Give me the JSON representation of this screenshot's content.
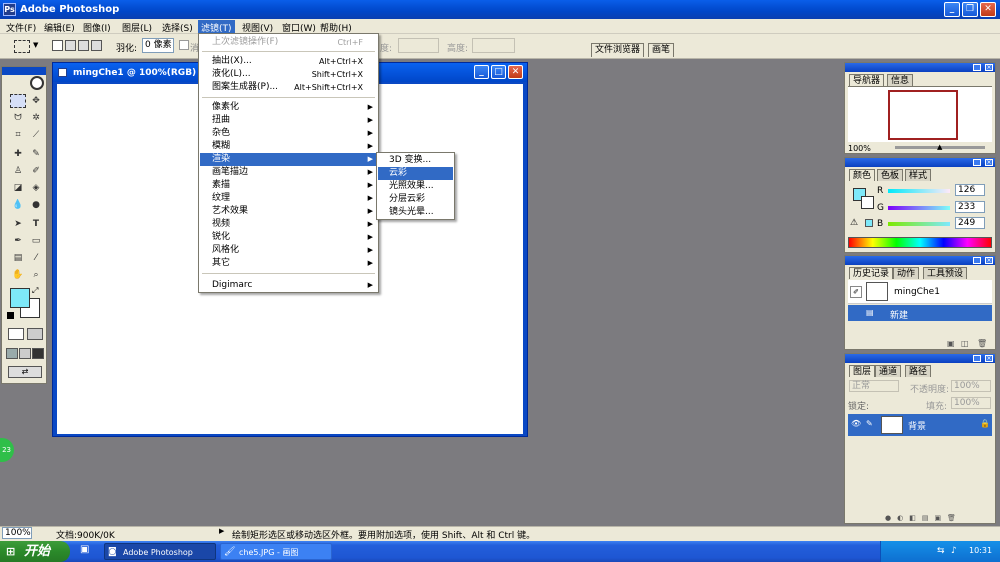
{
  "window": {
    "title": "Adobe Photoshop",
    "icon": "photoshop-app-icon"
  },
  "menubar": [
    {
      "label": "文件(F)",
      "active": false
    },
    {
      "label": "编辑(E)",
      "active": false
    },
    {
      "label": "图像(I)",
      "active": false
    },
    {
      "label": "图层(L)",
      "active": false
    },
    {
      "label": "选择(S)",
      "active": false
    },
    {
      "label": "滤镜(T)",
      "active": true
    },
    {
      "label": "视图(V)",
      "active": false
    },
    {
      "label": "窗口(W)",
      "active": false
    },
    {
      "label": "帮助(H)",
      "active": false
    }
  ],
  "options": {
    "feather_label": "羽化:",
    "feather_value": "0 像素",
    "antialias_label": "消",
    "width_label": "度:",
    "height_label": "高度:",
    "tabs": [
      "文件浏览器",
      "画笔"
    ]
  },
  "document": {
    "title": "mingChe1 @ 100%(RGB)"
  },
  "filter_menu": {
    "items": [
      {
        "label": "上次滤镜操作(F)",
        "shortcut": "Ctrl+F",
        "disabled": true,
        "submenu": false
      },
      {
        "separator": true
      },
      {
        "label": "抽出(X)...",
        "shortcut": "Alt+Ctrl+X",
        "submenu": false
      },
      {
        "label": "液化(L)...",
        "shortcut": "Shift+Ctrl+X",
        "submenu": false
      },
      {
        "label": "图案生成器(P)...",
        "shortcut": "Alt+Shift+Ctrl+X",
        "submenu": false
      },
      {
        "separator": true
      },
      {
        "label": "像素化",
        "submenu": true
      },
      {
        "label": "扭曲",
        "submenu": true
      },
      {
        "label": "杂色",
        "submenu": true
      },
      {
        "label": "模糊",
        "submenu": true
      },
      {
        "label": "渲染",
        "submenu": true,
        "selected": true
      },
      {
        "label": "画笔描边",
        "submenu": true
      },
      {
        "label": "素描",
        "submenu": true
      },
      {
        "label": "纹理",
        "submenu": true
      },
      {
        "label": "艺术效果",
        "submenu": true
      },
      {
        "label": "视频",
        "submenu": true
      },
      {
        "label": "锐化",
        "submenu": true
      },
      {
        "label": "风格化",
        "submenu": true
      },
      {
        "label": "其它",
        "submenu": true
      },
      {
        "separator": true
      },
      {
        "label": "Digimarc",
        "submenu": true
      }
    ]
  },
  "render_submenu": {
    "items": [
      {
        "label": "3D 变换..."
      },
      {
        "label": "云彩",
        "selected": true
      },
      {
        "label": "光照效果..."
      },
      {
        "label": "分层云彩"
      },
      {
        "label": "镜头光晕..."
      }
    ]
  },
  "navigator": {
    "tabs": [
      "导航器",
      "信息"
    ],
    "zoom": "100%"
  },
  "color": {
    "tabs": [
      "颜色",
      "色板",
      "样式"
    ],
    "channels": [
      {
        "label": "R",
        "value": "126"
      },
      {
        "label": "G",
        "value": "233"
      },
      {
        "label": "B",
        "value": "249"
      }
    ],
    "foreground": "#7ee9f9"
  },
  "history": {
    "tabs": [
      "历史记录",
      "动作",
      "工具预设"
    ],
    "snapshot": "mingChe1",
    "step": "新建"
  },
  "layers": {
    "tabs": [
      "图层",
      "通道",
      "路径"
    ],
    "blend_mode": "正常",
    "opacity_label": "不透明度:",
    "opacity_value": "100%",
    "lock_label": "锁定:",
    "fill_label": "填充:",
    "fill_value": "100%",
    "layer_name": "背景"
  },
  "status": {
    "zoom": "100%",
    "doc_info": "文档:900K/0K",
    "hint": "绘制矩形选区或移动选区外框。要用附加选项，使用 Shift、Alt 和 Ctrl 键。"
  },
  "taskbar": {
    "start_label": "开始",
    "tasks": [
      {
        "label": "Adobe Photoshop",
        "active": true
      },
      {
        "label": "che5.JPG - 画图",
        "active": false
      }
    ],
    "clock": "10:31"
  },
  "overlay": {
    "badge": "23"
  }
}
